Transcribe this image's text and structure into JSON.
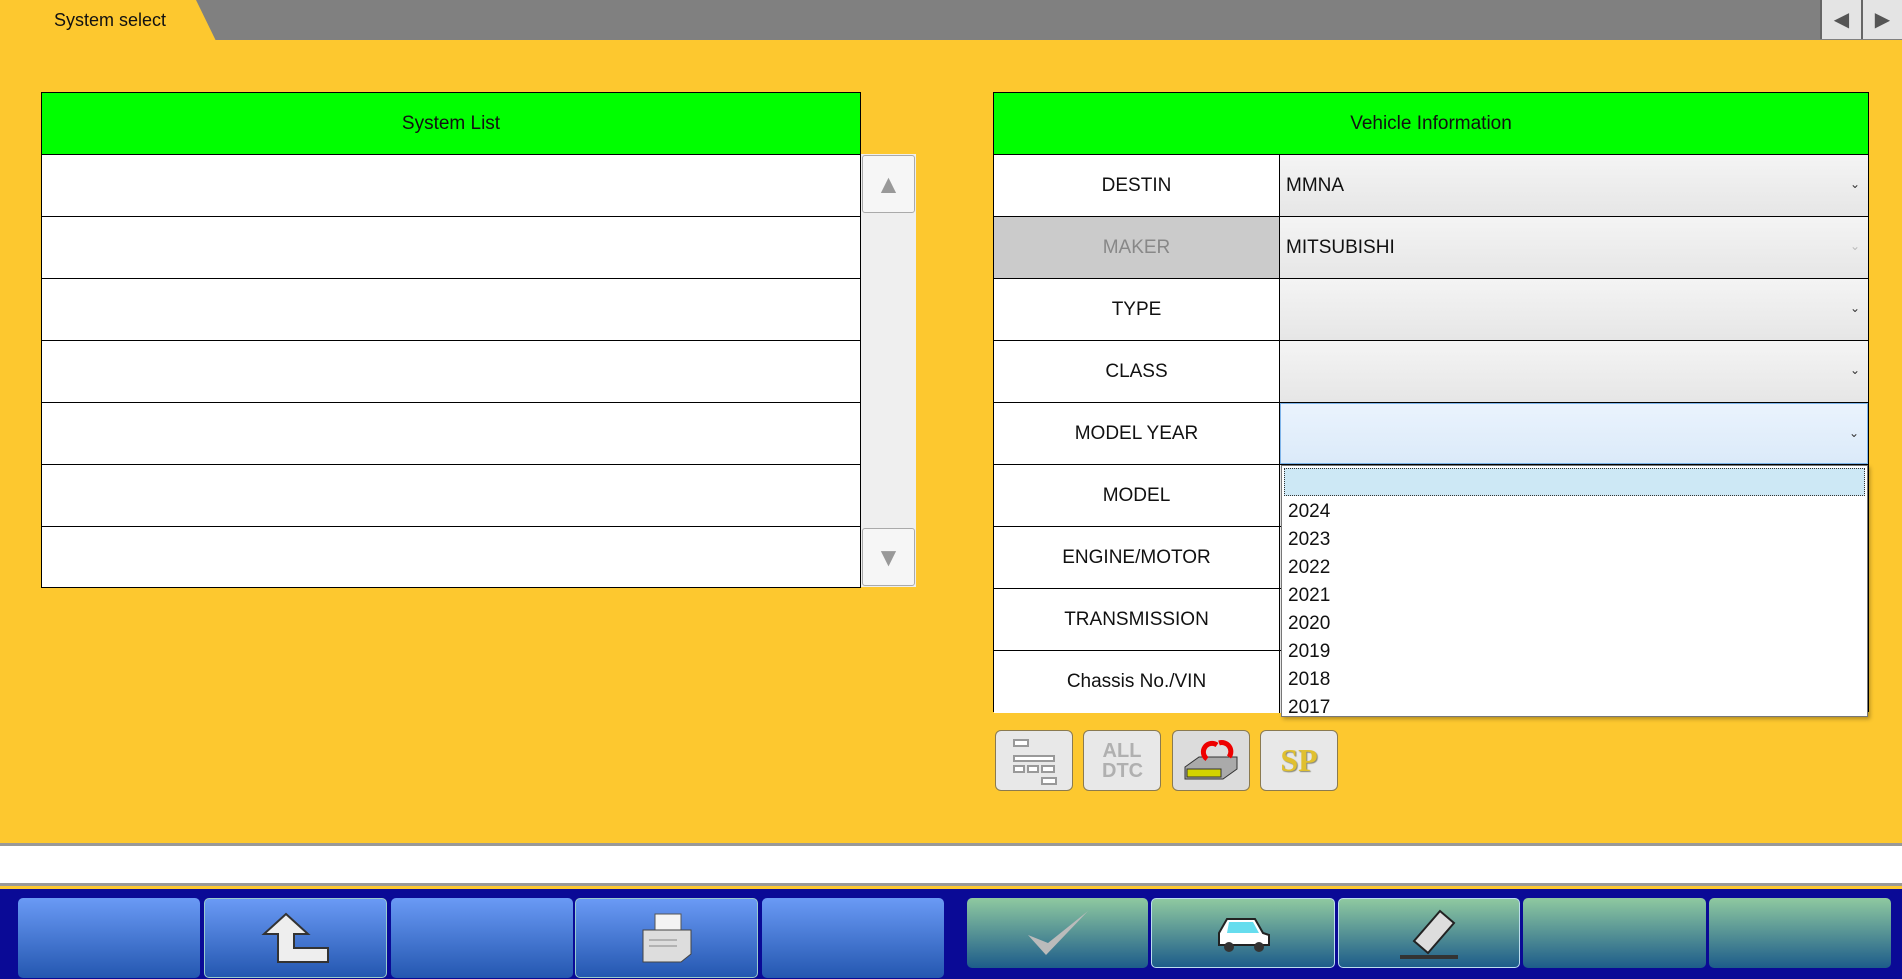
{
  "tab": {
    "title": "System select"
  },
  "system_list": {
    "header": "System List",
    "rows": [
      "",
      "",
      "",
      "",
      "",
      "",
      ""
    ]
  },
  "vehicle_info": {
    "header": "Vehicle Information",
    "fields": [
      {
        "label": "DESTIN",
        "value": "MMNA"
      },
      {
        "label": "MAKER",
        "value": "MITSUBISHI"
      },
      {
        "label": "TYPE",
        "value": ""
      },
      {
        "label": "CLASS",
        "value": ""
      },
      {
        "label": "MODEL YEAR",
        "value": ""
      },
      {
        "label": "MODEL",
        "value": ""
      },
      {
        "label": "ENGINE/MOTOR",
        "value": ""
      },
      {
        "label": "TRANSMISSION",
        "value": ""
      },
      {
        "label": "Chassis No./VIN",
        "value": ""
      }
    ]
  },
  "model_year_options": [
    "2024",
    "2023",
    "2022",
    "2021",
    "2020",
    "2019",
    "2018",
    "2017"
  ],
  "icon_buttons": {
    "all_dtc": "ALL DTC",
    "sp": "SP"
  },
  "status_text": ""
}
